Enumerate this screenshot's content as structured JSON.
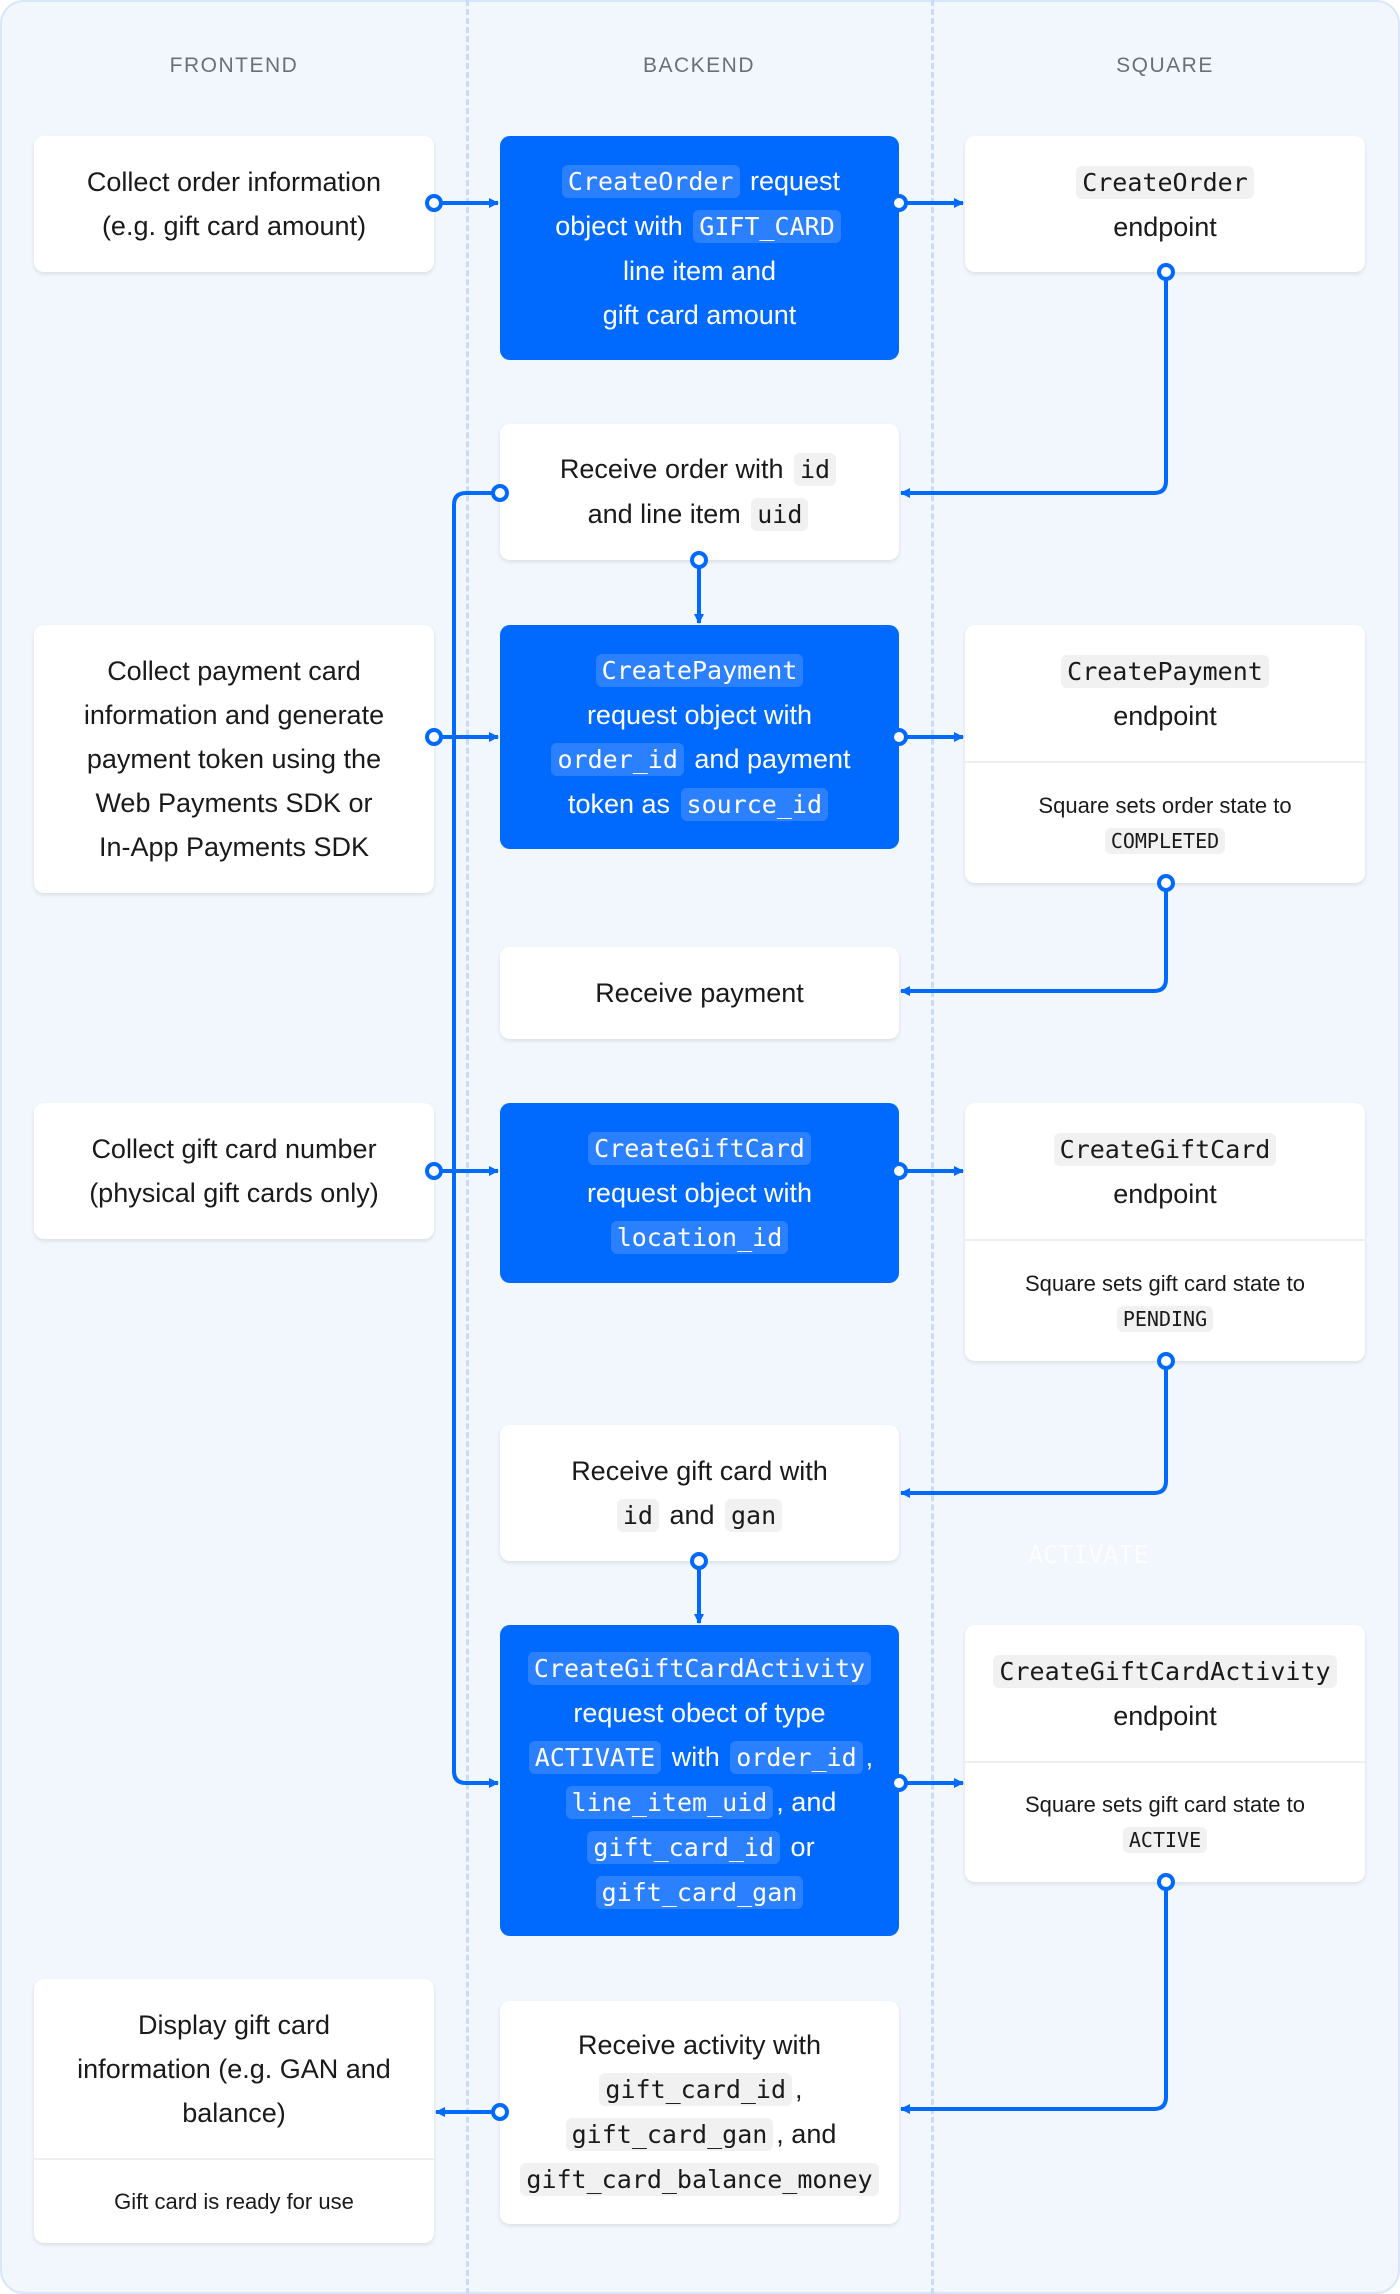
{
  "columns": [
    "FRONTEND",
    "BACKEND",
    "SQUARE"
  ],
  "accent": "#006aff",
  "ghost_label": "ACTIVATE",
  "boxes": [
    {
      "id": "f1",
      "name": "collect-order-info",
      "lines": [
        [
          {
            "t": "Collect order information"
          }
        ],
        [
          {
            "t": "(e.g. gift card amount)"
          }
        ]
      ]
    },
    {
      "id": "b1",
      "name": "create-order-request",
      "blue": true,
      "lines": [
        [
          {
            "t": "CreateOrder",
            "c": 1
          },
          {
            "t": " request"
          }
        ],
        [
          {
            "t": "object with "
          },
          {
            "t": "GIFT_CARD",
            "c": 1
          }
        ],
        [
          {
            "t": "line item and"
          }
        ],
        [
          {
            "t": "gift card amount"
          }
        ]
      ]
    },
    {
      "id": "s1",
      "name": "create-order-endpoint",
      "lines": [
        [
          {
            "t": "CreateOrder",
            "c": 1
          }
        ],
        [
          {
            "t": "endpoint"
          }
        ]
      ]
    },
    {
      "id": "b2",
      "name": "receive-order",
      "lines": [
        [
          {
            "t": "Receive order with "
          },
          {
            "t": "id",
            "c": 1
          }
        ],
        [
          {
            "t": "and line item "
          },
          {
            "t": "uid",
            "c": 1
          }
        ]
      ]
    },
    {
      "id": "f2",
      "name": "collect-payment-card",
      "lines": [
        [
          {
            "t": "Collect payment card"
          }
        ],
        [
          {
            "t": "information and generate"
          }
        ],
        [
          {
            "t": "payment token using the"
          }
        ],
        [
          {
            "t": "Web Payments SDK or"
          }
        ],
        [
          {
            "t": "In-App Payments SDK"
          }
        ]
      ]
    },
    {
      "id": "b3",
      "name": "create-payment-request",
      "blue": true,
      "lines": [
        [
          {
            "t": "CreatePayment",
            "c": 1
          }
        ],
        [
          {
            "t": "request object with"
          }
        ],
        [
          {
            "t": "order_id",
            "c": 1
          },
          {
            "t": " and payment"
          }
        ],
        [
          {
            "t": "token as "
          },
          {
            "t": "source_id",
            "c": 1
          }
        ]
      ]
    },
    {
      "id": "s2",
      "name": "create-payment-endpoint",
      "lines": [
        [
          {
            "t": "CreatePayment",
            "c": 1
          }
        ],
        [
          {
            "t": "endpoint"
          }
        ]
      ],
      "note": [
        [
          {
            "t": "Square sets order state to"
          }
        ],
        [
          {
            "t": "COMPLETED",
            "c": 1
          }
        ]
      ]
    },
    {
      "id": "b4",
      "name": "receive-payment",
      "lines": [
        [
          {
            "t": "Receive payment"
          }
        ]
      ]
    },
    {
      "id": "f3",
      "name": "collect-gift-card-number",
      "lines": [
        [
          {
            "t": "Collect gift card number"
          }
        ],
        [
          {
            "t": "(physical gift cards only)"
          }
        ]
      ]
    },
    {
      "id": "b5",
      "name": "create-gift-card-request",
      "blue": true,
      "lines": [
        [
          {
            "t": "CreateGiftCard",
            "c": 1
          }
        ],
        [
          {
            "t": "request object with"
          }
        ],
        [
          {
            "t": "location_id",
            "c": 1
          }
        ]
      ]
    },
    {
      "id": "s3",
      "name": "create-gift-card-endpoint",
      "lines": [
        [
          {
            "t": "CreateGiftCard",
            "c": 1
          }
        ],
        [
          {
            "t": "endpoint"
          }
        ]
      ],
      "note": [
        [
          {
            "t": "Square sets gift card state to"
          }
        ],
        [
          {
            "t": "PENDING",
            "c": 1
          }
        ]
      ]
    },
    {
      "id": "b6",
      "name": "receive-gift-card",
      "lines": [
        [
          {
            "t": "Receive gift card with"
          }
        ],
        [
          {
            "t": "id",
            "c": 1
          },
          {
            "t": " and "
          },
          {
            "t": "gan",
            "c": 1
          }
        ]
      ]
    },
    {
      "id": "b7",
      "name": "create-gift-card-activity-request",
      "blue": true,
      "lines": [
        [
          {
            "t": "CreateGiftCardActivity",
            "c": 1
          }
        ],
        [
          {
            "t": "request obect of type"
          }
        ],
        [
          {
            "t": "ACTIVATE",
            "c": 1
          },
          {
            "t": " with "
          },
          {
            "t": "order_id",
            "c": 1
          },
          {
            "t": ","
          }
        ],
        [
          {
            "t": "line_item_uid",
            "c": 1
          },
          {
            "t": ", and"
          }
        ],
        [
          {
            "t": "gift_card_id",
            "c": 1
          },
          {
            "t": " or"
          }
        ],
        [
          {
            "t": "gift_card_gan",
            "c": 1
          }
        ]
      ]
    },
    {
      "id": "s4",
      "name": "create-gift-card-activity-endpoint",
      "lines": [
        [
          {
            "t": "CreateGiftCardActivity",
            "c": 1
          }
        ],
        [
          {
            "t": "endpoint"
          }
        ]
      ],
      "note": [
        [
          {
            "t": "Square sets gift card state to"
          }
        ],
        [
          {
            "t": "ACTIVE",
            "c": 1
          }
        ]
      ]
    },
    {
      "id": "f4",
      "name": "display-gift-card-info",
      "lines": [
        [
          {
            "t": "Display gift card"
          }
        ],
        [
          {
            "t": "information (e.g. GAN and"
          }
        ],
        [
          {
            "t": "balance)"
          }
        ]
      ],
      "note": [
        [
          {
            "t": "Gift card is ready for use"
          }
        ]
      ]
    },
    {
      "id": "b8",
      "name": "receive-activity",
      "lines": [
        [
          {
            "t": "Receive activity with"
          }
        ],
        [
          {
            "t": "gift_card_id",
            "c": 1
          },
          {
            "t": ","
          }
        ],
        [
          {
            "t": "gift_card_gan",
            "c": 1
          },
          {
            "t": ", and"
          }
        ],
        [
          {
            "t": "gift_card_balance_money",
            "c": 1
          }
        ]
      ]
    }
  ]
}
